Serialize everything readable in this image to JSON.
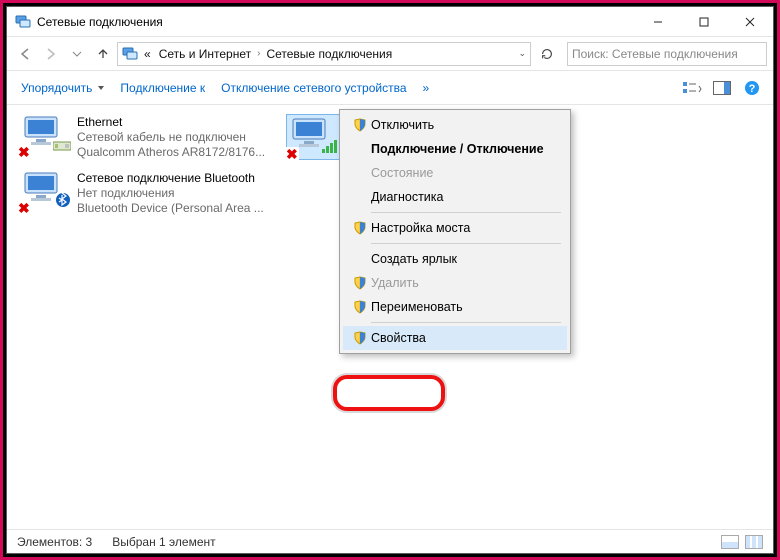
{
  "window": {
    "title": "Сетевые подключения"
  },
  "address": {
    "prefix": "«",
    "part1": "Сеть и Интернет",
    "part2": "Сетевые подключения"
  },
  "search": {
    "placeholder": "Поиск: Сетевые подключения"
  },
  "toolbar": {
    "organize": "Упорядочить",
    "connect": "Подключение к",
    "disable": "Отключение сетевого устройства",
    "overflow": "»"
  },
  "items": [
    {
      "name": "Ethernet",
      "line2": "Сетевой кабель не подключен",
      "line3": "Qualcomm Atheros AR8172/8176...",
      "extra": "nic"
    },
    {
      "name": "Сетевое подключение Bluetooth",
      "line2": "Нет подключения",
      "line3": "Bluetooth Device (Personal Area ...",
      "extra": "bt"
    },
    {
      "name": "",
      "line2": "",
      "line3": "",
      "extra": "wifi"
    }
  ],
  "context": {
    "items": [
      {
        "label": "Отключить",
        "icon": "shield",
        "enabled": true,
        "bold": false
      },
      {
        "label": "Подключение / Отключение",
        "icon": "",
        "enabled": true,
        "bold": true
      },
      {
        "label": "Состояние",
        "icon": "",
        "enabled": false,
        "bold": false
      },
      {
        "label": "Диагностика",
        "icon": "",
        "enabled": true,
        "bold": false
      },
      {
        "sep": true
      },
      {
        "label": "Настройка моста",
        "icon": "shield",
        "enabled": true,
        "bold": false
      },
      {
        "sep": true
      },
      {
        "label": "Создать ярлык",
        "icon": "",
        "enabled": true,
        "bold": false
      },
      {
        "label": "Удалить",
        "icon": "shield",
        "enabled": false,
        "bold": false
      },
      {
        "label": "Переименовать",
        "icon": "shield",
        "enabled": true,
        "bold": false
      },
      {
        "sep": true
      },
      {
        "label": "Свойства",
        "icon": "shield",
        "enabled": true,
        "bold": false,
        "highlight": true
      }
    ]
  },
  "status": {
    "count_label": "Элементов: 3",
    "sel_label": "Выбран 1 элемент"
  }
}
